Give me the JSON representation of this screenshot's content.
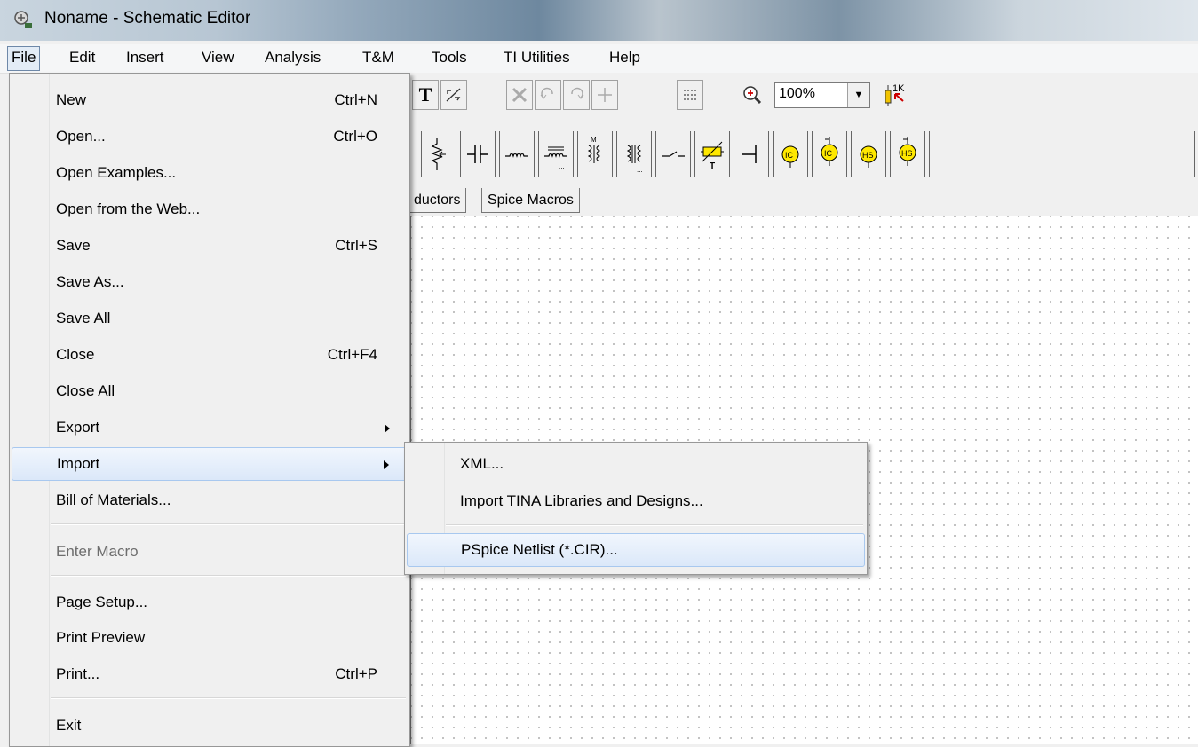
{
  "window": {
    "title": "Noname - Schematic Editor"
  },
  "menubar": [
    "File",
    "Edit",
    "Insert",
    "View",
    "Analysis",
    "T&M",
    "Tools",
    "TI Utilities",
    "Help"
  ],
  "file_menu": {
    "new": {
      "label": "New",
      "shortcut": "Ctrl+N"
    },
    "open": {
      "label": "Open...",
      "shortcut": "Ctrl+O"
    },
    "open_examples": {
      "label": "Open Examples..."
    },
    "open_web": {
      "label": "Open from the Web..."
    },
    "save": {
      "label": "Save",
      "shortcut": "Ctrl+S"
    },
    "save_as": {
      "label": "Save As..."
    },
    "save_all": {
      "label": "Save All"
    },
    "close": {
      "label": "Close",
      "shortcut": "Ctrl+F4"
    },
    "close_all": {
      "label": "Close All"
    },
    "export": {
      "label": "Export"
    },
    "import": {
      "label": "Import"
    },
    "bom": {
      "label": "Bill of Materials..."
    },
    "enter_macro": {
      "label": "Enter Macro"
    },
    "page_setup": {
      "label": "Page Setup..."
    },
    "print_preview": {
      "label": "Print Preview"
    },
    "print": {
      "label": "Print...",
      "shortcut": "Ctrl+P"
    },
    "exit": {
      "label": "Exit"
    }
  },
  "import_submenu": [
    "XML...",
    "Import TINA Libraries and Designs...",
    "PSpice Netlist (*.CIR)..."
  ],
  "toolbar": {
    "zoom": "100%",
    "resistor_label": "1K"
  },
  "component_tabs": [
    "ductors",
    "Spice Macros"
  ],
  "colors": {
    "menu_highlight": "#dbe8f9",
    "ic_yellow": "#ffe800"
  }
}
